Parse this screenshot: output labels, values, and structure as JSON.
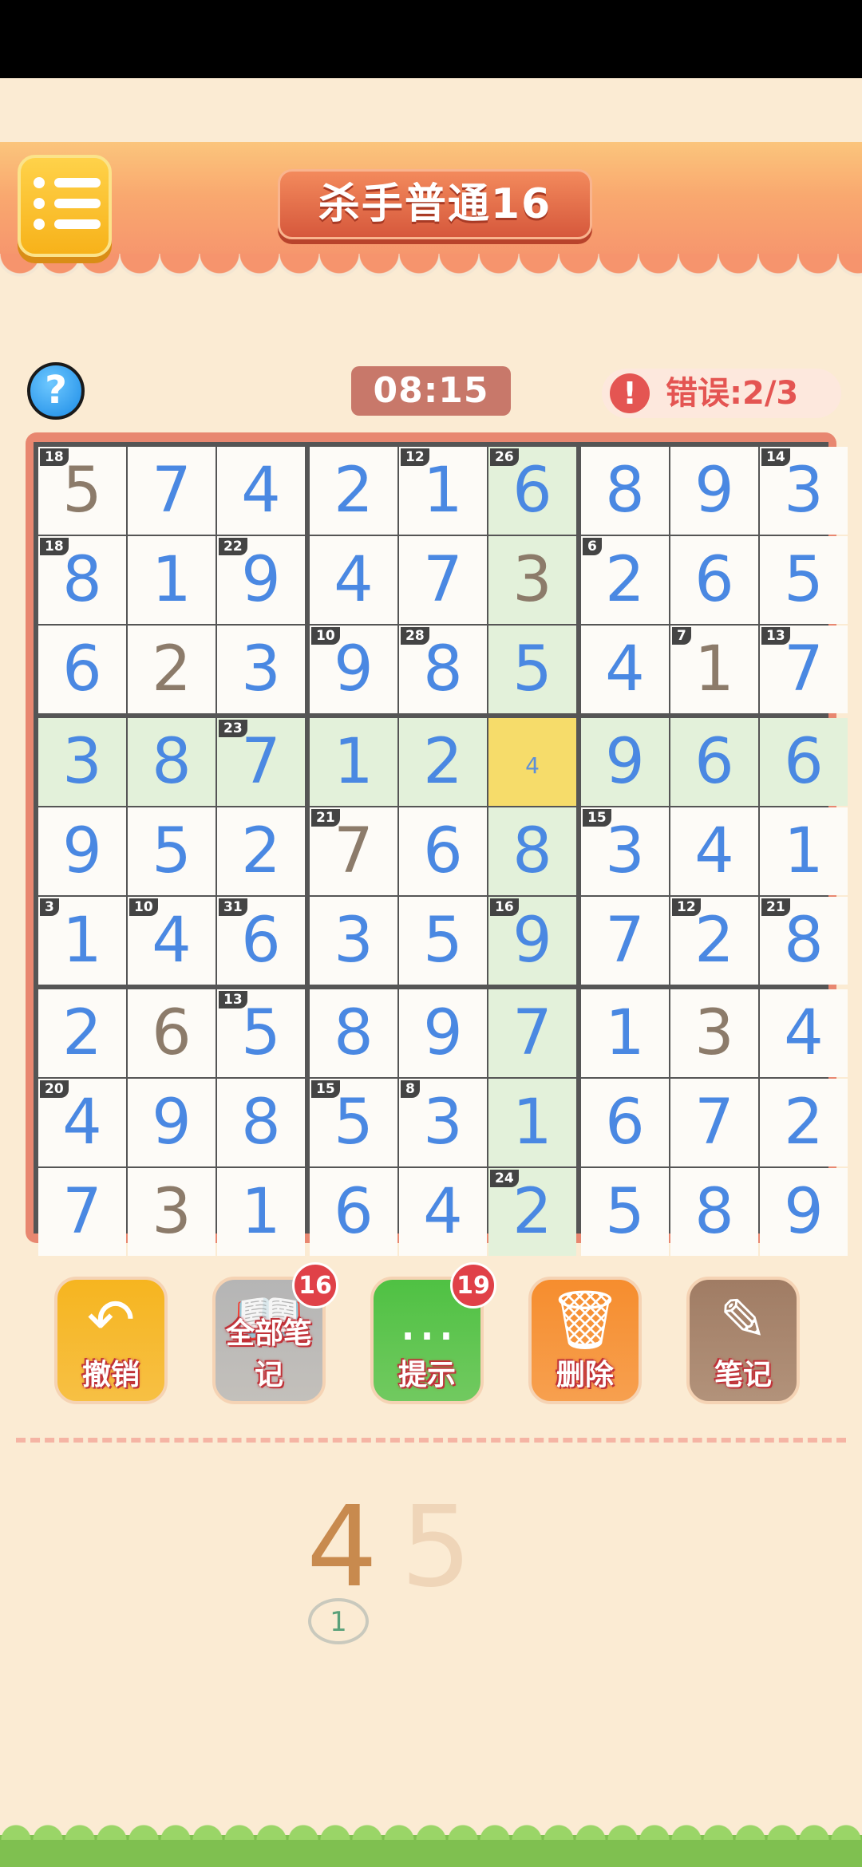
{
  "header": {
    "title": "杀手普通16"
  },
  "status": {
    "timer": "08:15",
    "errors_label": "错误:2/3",
    "error_icon": "!",
    "help_icon": "?"
  },
  "board": {
    "rows": [
      [
        "5",
        "7",
        "4",
        "2",
        "1",
        "6",
        "8",
        "9",
        "3"
      ],
      [
        "8",
        "1",
        "9",
        "4",
        "7",
        "3",
        "2",
        "6",
        "5"
      ],
      [
        "6",
        "2",
        "3",
        "9",
        "8",
        "5",
        "4",
        "1",
        "7"
      ],
      [
        "3",
        "8",
        "7",
        "1",
        "2",
        "",
        "9",
        "6",
        "6"
      ],
      [
        "9",
        "5",
        "2",
        "7",
        "6",
        "8",
        "3",
        "4",
        "1"
      ],
      [
        "1",
        "4",
        "6",
        "3",
        "5",
        "9",
        "7",
        "2",
        "8"
      ],
      [
        "2",
        "6",
        "5",
        "8",
        "9",
        "7",
        "1",
        "3",
        "4"
      ],
      [
        "4",
        "9",
        "8",
        "5",
        "3",
        "1",
        "6",
        "7",
        "2"
      ],
      [
        "7",
        "3",
        "1",
        "6",
        "4",
        "2",
        "5",
        "8",
        "9"
      ]
    ],
    "given": [
      [
        0,
        0
      ],
      [
        1,
        5
      ],
      [
        2,
        1
      ],
      [
        2,
        7
      ],
      [
        4,
        3
      ],
      [
        6,
        1
      ],
      [
        6,
        7
      ],
      [
        8,
        1
      ]
    ],
    "selected": [
      3,
      5
    ],
    "selected_note": "4",
    "cages": [
      {
        "r": 0,
        "c": 0,
        "sum": "18"
      },
      {
        "r": 0,
        "c": 4,
        "sum": "12"
      },
      {
        "r": 0,
        "c": 5,
        "sum": "26"
      },
      {
        "r": 0,
        "c": 8,
        "sum": "14"
      },
      {
        "r": 1,
        "c": 0,
        "sum": "18"
      },
      {
        "r": 1,
        "c": 2,
        "sum": "22"
      },
      {
        "r": 1,
        "c": 6,
        "sum": "6"
      },
      {
        "r": 2,
        "c": 3,
        "sum": "10"
      },
      {
        "r": 2,
        "c": 4,
        "sum": "28"
      },
      {
        "r": 2,
        "c": 7,
        "sum": "7"
      },
      {
        "r": 2,
        "c": 8,
        "sum": "13"
      },
      {
        "r": 3,
        "c": 2,
        "sum": "23"
      },
      {
        "r": 4,
        "c": 3,
        "sum": "21"
      },
      {
        "r": 4,
        "c": 6,
        "sum": "15"
      },
      {
        "r": 5,
        "c": 0,
        "sum": "3"
      },
      {
        "r": 5,
        "c": 1,
        "sum": "10"
      },
      {
        "r": 5,
        "c": 2,
        "sum": "31"
      },
      {
        "r": 5,
        "c": 5,
        "sum": "16"
      },
      {
        "r": 5,
        "c": 7,
        "sum": "12"
      },
      {
        "r": 5,
        "c": 8,
        "sum": "21"
      },
      {
        "r": 6,
        "c": 2,
        "sum": "13"
      },
      {
        "r": 7,
        "c": 0,
        "sum": "20"
      },
      {
        "r": 7,
        "c": 3,
        "sum": "15"
      },
      {
        "r": 7,
        "c": 4,
        "sum": "8"
      },
      {
        "r": 8,
        "c": 5,
        "sum": "24"
      }
    ],
    "colors": {
      "cell": "#fdfbf7",
      "highlight": "#e3f1da",
      "selected": "#f6dc6a",
      "number": "#4a88e2",
      "given_number": "#8c7b6a"
    }
  },
  "toolbar": [
    {
      "label": "撤销",
      "icon": "undo-arrow-icon",
      "color": "#f6b520",
      "badge": ""
    },
    {
      "label": "全部笔记",
      "icon": "open-book-icon",
      "color": "#b5b5b5",
      "badge": "16"
    },
    {
      "label": "提示",
      "icon": "chat-bubble-icon",
      "color": "#4fc143",
      "badge": "19"
    },
    {
      "label": "删除",
      "icon": "trash-can-icon",
      "color": "#f68d2e",
      "badge": ""
    },
    {
      "label": "笔记",
      "icon": "notepad-pencil-icon",
      "color": "#a07c64",
      "badge": ""
    }
  ],
  "picker": {
    "first": "4",
    "second": "5",
    "count": "1",
    "first_color": "#c88a4e",
    "second_color": "#efd5b8"
  }
}
